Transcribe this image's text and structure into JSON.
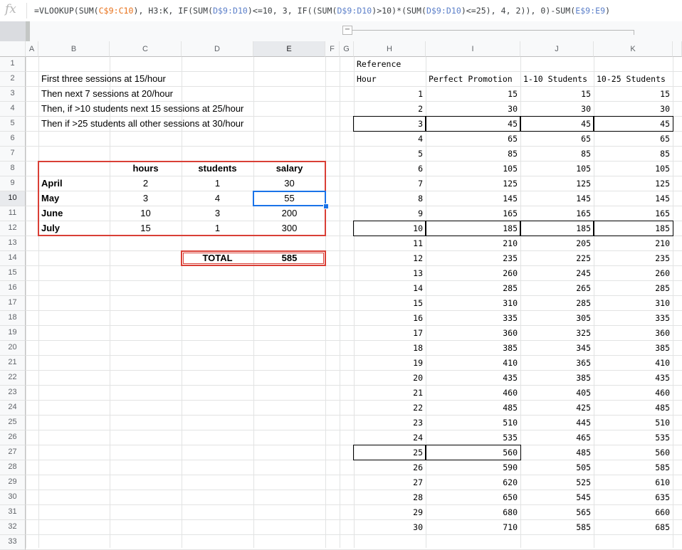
{
  "formula_bar": {
    "fx_icon": "fx",
    "segments": [
      {
        "t": "=VLOOKUP(SUM(",
        "c": ""
      },
      {
        "t": "C$9:C10",
        "c": "fr"
      },
      {
        "t": "), H3:K, IF(SUM(",
        "c": ""
      },
      {
        "t": "D$9:D10",
        "c": "fb"
      },
      {
        "t": ")<=10, 3, IF((SUM(",
        "c": ""
      },
      {
        "t": "D$9:D10",
        "c": "fb"
      },
      {
        "t": ")>10)*(SUM(",
        "c": ""
      },
      {
        "t": "D$9:D10",
        "c": "fb"
      },
      {
        "t": ")<=25), 4, 2)), 0)-SUM(",
        "c": ""
      },
      {
        "t": "E$9:E9",
        "c": "fb"
      },
      {
        "t": ")",
        "c": ""
      }
    ]
  },
  "group_toggle": "−",
  "columns": [
    "A",
    "B",
    "C",
    "D",
    "E",
    "F",
    "G",
    "H",
    "I",
    "J",
    "K"
  ],
  "selected_column": "E",
  "rows": [
    "1",
    "2",
    "3",
    "4",
    "5",
    "6",
    "7",
    "8",
    "9",
    "10",
    "11",
    "12",
    "13",
    "14",
    "15",
    "16",
    "17",
    "18",
    "19",
    "20",
    "21",
    "22",
    "23",
    "24",
    "25",
    "26",
    "27",
    "28",
    "29",
    "30",
    "31",
    "32",
    "33"
  ],
  "selected_row": "10",
  "notes": [
    "First three sessions at 15/hour",
    "Then next 7 sessions at 20/hour",
    "Then, if >10 students next 15 sessions at 25/hour",
    "Then if >25 students all other sessions at 30/hour"
  ],
  "salary_table": {
    "headers": [
      "hours",
      "students",
      "salary"
    ],
    "rows": [
      {
        "month": "April",
        "hours": "2",
        "students": "1",
        "salary": "30"
      },
      {
        "month": "May",
        "hours": "3",
        "students": "4",
        "salary": "55"
      },
      {
        "month": "June",
        "hours": "10",
        "students": "3",
        "salary": "200"
      },
      {
        "month": "July",
        "hours": "15",
        "students": "1",
        "salary": "300"
      }
    ]
  },
  "total": {
    "label": "TOTAL",
    "value": "585"
  },
  "reference": {
    "title": "Reference",
    "headers": [
      "Hour",
      "Perfect Promotion",
      "1-10 Students",
      "10-25 Students"
    ],
    "rows": [
      [
        "1",
        "15",
        "15",
        "15"
      ],
      [
        "2",
        "30",
        "30",
        "30"
      ],
      [
        "3",
        "45",
        "45",
        "45"
      ],
      [
        "4",
        "65",
        "65",
        "65"
      ],
      [
        "5",
        "85",
        "85",
        "85"
      ],
      [
        "6",
        "105",
        "105",
        "105"
      ],
      [
        "7",
        "125",
        "125",
        "125"
      ],
      [
        "8",
        "145",
        "145",
        "145"
      ],
      [
        "9",
        "165",
        "165",
        "165"
      ],
      [
        "10",
        "185",
        "185",
        "185"
      ],
      [
        "11",
        "210",
        "205",
        "210"
      ],
      [
        "12",
        "235",
        "225",
        "235"
      ],
      [
        "13",
        "260",
        "245",
        "260"
      ],
      [
        "14",
        "285",
        "265",
        "285"
      ],
      [
        "15",
        "310",
        "285",
        "310"
      ],
      [
        "16",
        "335",
        "305",
        "335"
      ],
      [
        "17",
        "360",
        "325",
        "360"
      ],
      [
        "18",
        "385",
        "345",
        "385"
      ],
      [
        "19",
        "410",
        "365",
        "410"
      ],
      [
        "20",
        "435",
        "385",
        "435"
      ],
      [
        "21",
        "460",
        "405",
        "460"
      ],
      [
        "22",
        "485",
        "425",
        "485"
      ],
      [
        "23",
        "510",
        "445",
        "510"
      ],
      [
        "24",
        "535",
        "465",
        "535"
      ],
      [
        "25",
        "560",
        "485",
        "560"
      ],
      [
        "26",
        "590",
        "505",
        "585"
      ],
      [
        "27",
        "620",
        "525",
        "610"
      ],
      [
        "28",
        "650",
        "545",
        "635"
      ],
      [
        "29",
        "680",
        "565",
        "660"
      ],
      [
        "30",
        "710",
        "585",
        "685"
      ]
    ]
  }
}
